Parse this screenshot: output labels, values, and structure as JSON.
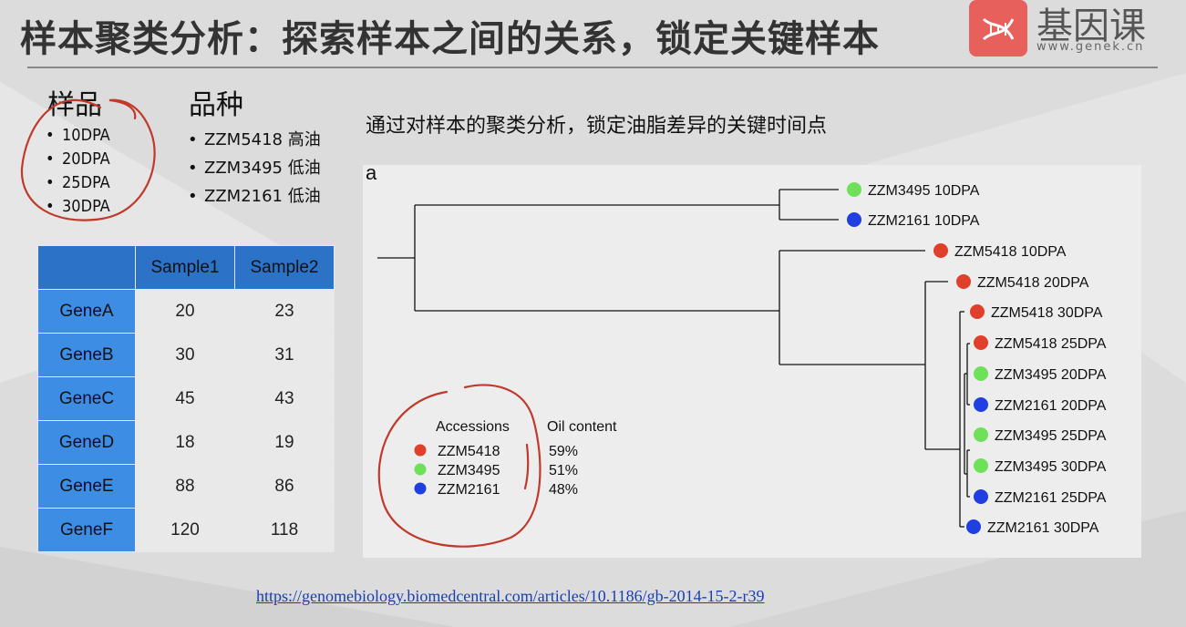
{
  "title": "样本聚类分析：探索样本之间的关系，锁定关键样本",
  "logo": {
    "title": "基因课",
    "url": "www.genek.cn",
    "brand_color": "#e8605b"
  },
  "samples": {
    "heading": "样品",
    "items": [
      "10DPA",
      "20DPA",
      "25DPA",
      "30DPA"
    ]
  },
  "varieties": {
    "heading": "品种",
    "items": [
      "ZZM5418 高油",
      "ZZM3495 低油",
      "ZZM2161 低油"
    ]
  },
  "table": {
    "headers": [
      "",
      "Sample1",
      "Sample2"
    ],
    "rows": [
      {
        "gene": "GeneA",
        "s1": "20",
        "s2": "23"
      },
      {
        "gene": "GeneB",
        "s1": "30",
        "s2": "31"
      },
      {
        "gene": "GeneC",
        "s1": "45",
        "s2": "43"
      },
      {
        "gene": "GeneD",
        "s1": "18",
        "s2": "19"
      },
      {
        "gene": "GeneE",
        "s1": "88",
        "s2": "86"
      },
      {
        "gene": "GeneF",
        "s1": "120",
        "s2": "118"
      }
    ]
  },
  "subtitle": "通过对样本的聚类分析，锁定油脂差异的关键时间点",
  "dendrogram": {
    "panel_label": "a",
    "colors": {
      "ZZM5418": "#e0402b",
      "ZZM3495": "#6fe05a",
      "ZZM2161": "#1f3fe0"
    },
    "leaves": [
      {
        "accession": "ZZM3495",
        "label": "ZZM3495 10DPA"
      },
      {
        "accession": "ZZM2161",
        "label": "ZZM2161 10DPA"
      },
      {
        "accession": "ZZM5418",
        "label": "ZZM5418 10DPA"
      },
      {
        "accession": "ZZM5418",
        "label": "ZZM5418 20DPA"
      },
      {
        "accession": "ZZM5418",
        "label": "ZZM5418 30DPA"
      },
      {
        "accession": "ZZM5418",
        "label": "ZZM5418 25DPA"
      },
      {
        "accession": "ZZM3495",
        "label": "ZZM3495 20DPA"
      },
      {
        "accession": "ZZM2161",
        "label": "ZZM2161 20DPA"
      },
      {
        "accession": "ZZM3495",
        "label": "ZZM3495 25DPA"
      },
      {
        "accession": "ZZM3495",
        "label": "ZZM3495 30DPA"
      },
      {
        "accession": "ZZM2161",
        "label": "ZZM2161 25DPA"
      },
      {
        "accession": "ZZM2161",
        "label": "ZZM2161 30DPA"
      }
    ],
    "legend": {
      "col1_heading": "Accessions",
      "col2_heading": "Oil content",
      "rows": [
        {
          "accession": "ZZM5418",
          "oil": "59%"
        },
        {
          "accession": "ZZM3495",
          "oil": "51%"
        },
        {
          "accession": "ZZM2161",
          "oil": "48%"
        }
      ]
    }
  },
  "url": "https://genomebiology.biomedcentral.com/articles/10.1186/gb-2014-15-2-r39",
  "annotation_color": "#c0392b"
}
